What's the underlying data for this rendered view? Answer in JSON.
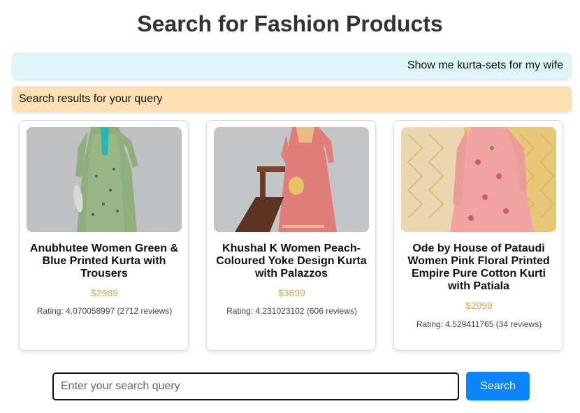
{
  "page": {
    "title": "Search for Fashion Products"
  },
  "chat": {
    "user_query": "Show me kurta-sets for my wife",
    "results_header": "Search results for your query"
  },
  "products": [
    {
      "title": "Anubhutee Women Green & Blue Printed Kurta with Trousers",
      "price": "$2989",
      "rating": "Rating: 4.070058997 (2712 reviews)"
    },
    {
      "title": "Khushal K Women Peach-Coloured Yoke Design Kurta with Palazzos",
      "price": "$3699",
      "rating": "Rating: 4.231023102 (606 reviews)"
    },
    {
      "title": "Ode by House of Pataudi Women Pink Floral Printed Empire Pure Cotton Kurti with Patiala",
      "price": "$2999",
      "rating": "Rating: 4.529411765 (34 reviews)"
    }
  ],
  "search": {
    "placeholder": "Enter your search query",
    "value": "",
    "button_label": "Search"
  },
  "colors": {
    "query_bubble": "#dff6f9",
    "results_bubble": "#ffe0b2",
    "price": "#e8a33d",
    "button": "#0a84ff"
  }
}
